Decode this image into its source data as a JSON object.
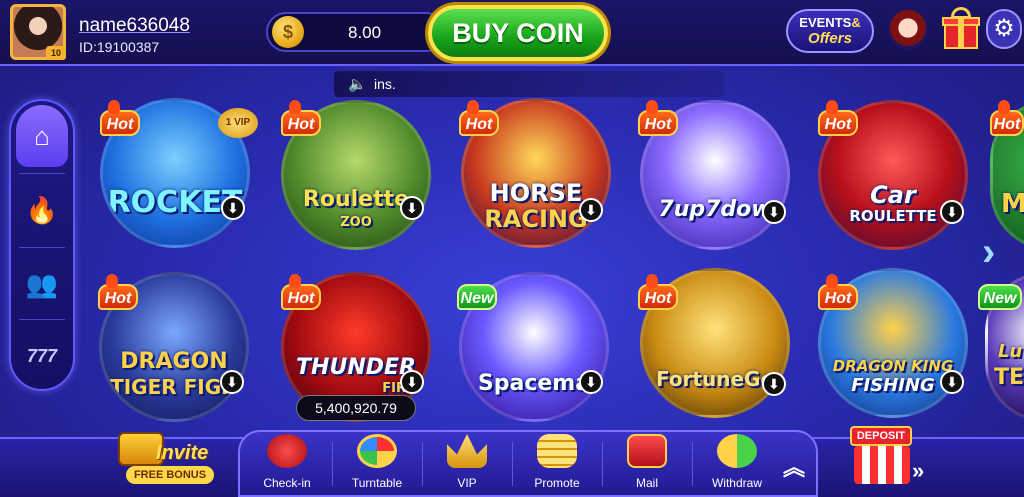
{
  "user": {
    "name": "name636048",
    "id": "ID:19100387",
    "level": "10"
  },
  "wallet": {
    "balance": "8.00",
    "coin_symbol": "$",
    "buy_coin_label": "BUY COIN"
  },
  "header": {
    "events_line1": "EVENTS",
    "events_amp": "&",
    "events_line2": "Offers",
    "settings_glyph": "⚙"
  },
  "marquee": {
    "speaker_glyph": "🔈",
    "text": "ins."
  },
  "sidenav": {
    "items": [
      {
        "name": "home",
        "glyph": "⌂"
      },
      {
        "name": "hot",
        "glyph": "🔥"
      },
      {
        "name": "players",
        "glyph": "👥"
      },
      {
        "name": "slots",
        "glyph": "777"
      }
    ]
  },
  "games": [
    {
      "title": "ROCKET",
      "badge": "Hot",
      "extra": "1 VIP"
    },
    {
      "title": "Roulette",
      "subtitle": "ZOO",
      "badge": "Hot"
    },
    {
      "title": "HORSE",
      "subtitle": "RACING",
      "badge": "Hot"
    },
    {
      "title": "7up7dow",
      "badge": "Hot"
    },
    {
      "title": "Car",
      "subtitle": "ROULETTE",
      "badge": "Hot"
    },
    {
      "title": "M",
      "badge": "Hot"
    },
    {
      "title": "DRAGON",
      "subtitle": "TIGER FIGH",
      "badge": "Hot"
    },
    {
      "title": "THUNDER",
      "subtitle": "FIR",
      "badge": "Hot",
      "jackpot": "5,400,920.79"
    },
    {
      "title": "Spacema",
      "badge": "New"
    },
    {
      "title": "FortuneGe",
      "badge": "Hot"
    },
    {
      "title": "DRAGON KING",
      "subtitle": "FISHING",
      "badge": "Hot"
    },
    {
      "title": "Lu",
      "subtitle": "TE",
      "badge": "New"
    }
  ],
  "download_glyph": "⬇",
  "next_arrow": "›",
  "bottom": {
    "invite_label": "Invite",
    "invite_sub": "FREE BONUS",
    "menu": [
      {
        "label": "Check-in",
        "color": "#d8242c"
      },
      {
        "label": "Turntable",
        "color": "#f5b52b"
      },
      {
        "label": "VIP",
        "color": "#f2b233"
      },
      {
        "label": "Promote",
        "color": "#f5c23a"
      },
      {
        "label": "Mail",
        "color": "#d8242c"
      },
      {
        "label": "Withdraw",
        "color": "#4bd24b"
      }
    ],
    "collapse_glyph": "︽",
    "deposit_label": "DEPOSIT",
    "deposit_arrow": "»"
  }
}
